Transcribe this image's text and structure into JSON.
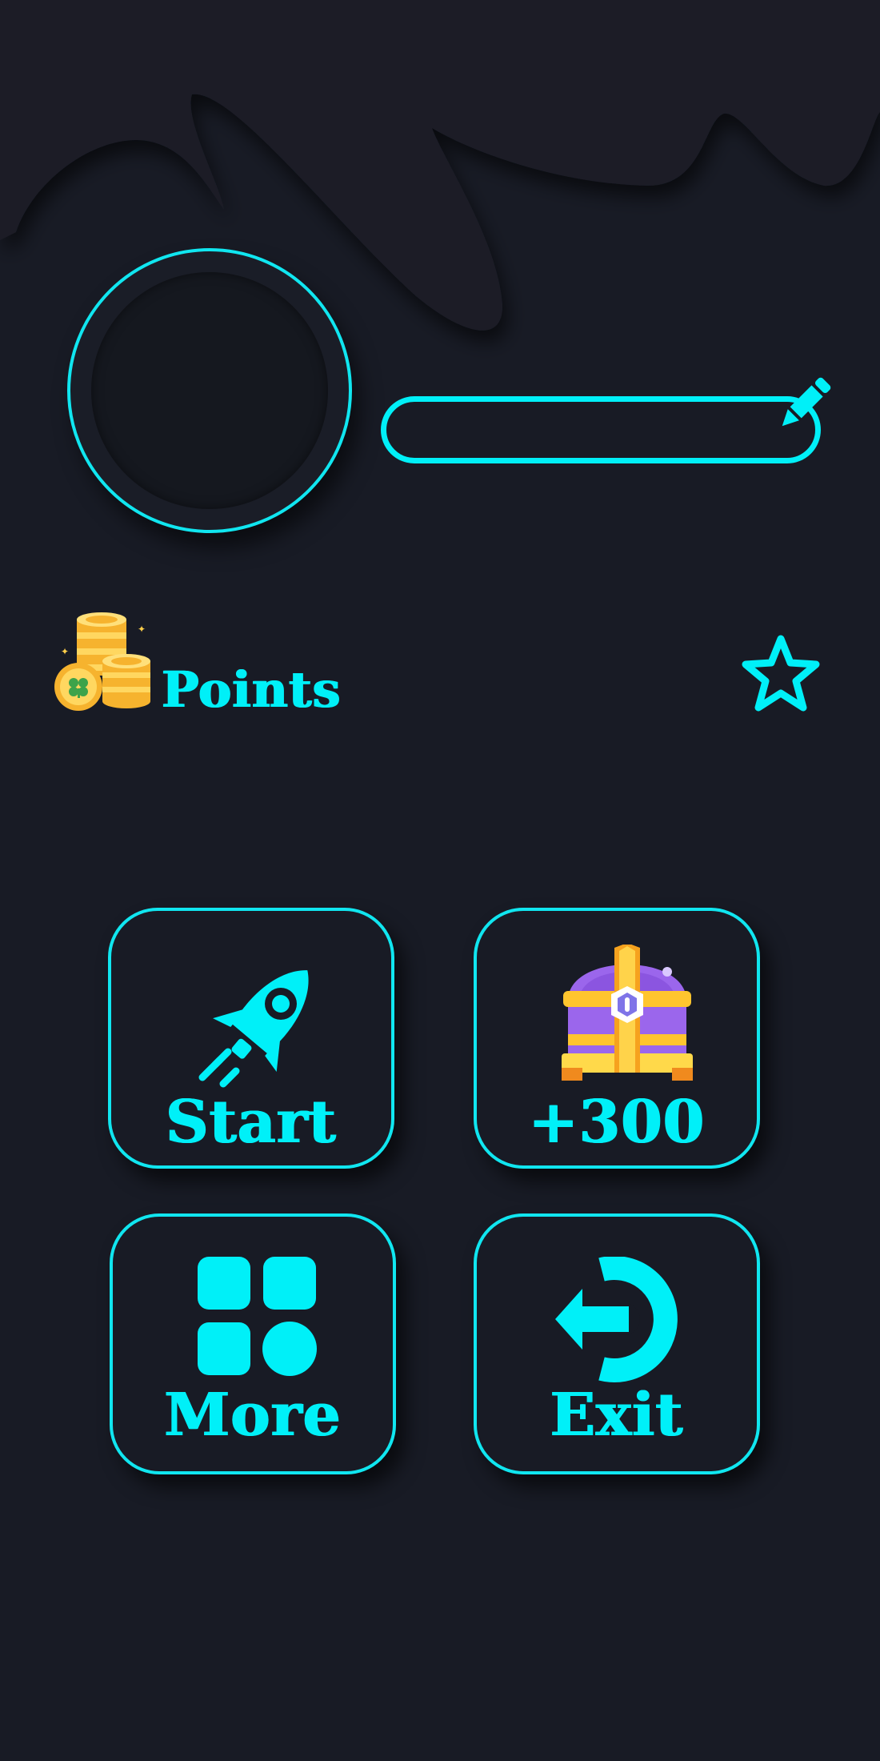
{
  "profile": {
    "name_value": "",
    "name_placeholder": ""
  },
  "points": {
    "label": "Points"
  },
  "menu": {
    "start_label": "Start",
    "reward_label": "+300",
    "more_label": "More",
    "exit_label": "Exit"
  },
  "colors": {
    "background": "#181b25",
    "accent": "#00f0f8"
  },
  "icons": {
    "edit": "pencil-icon",
    "favorite": "star-outline-icon",
    "coins": "coin-stack-icon",
    "start": "rocket-icon",
    "reward": "treasure-chest-icon",
    "more": "grid-apps-icon",
    "exit": "logout-arrow-icon"
  }
}
